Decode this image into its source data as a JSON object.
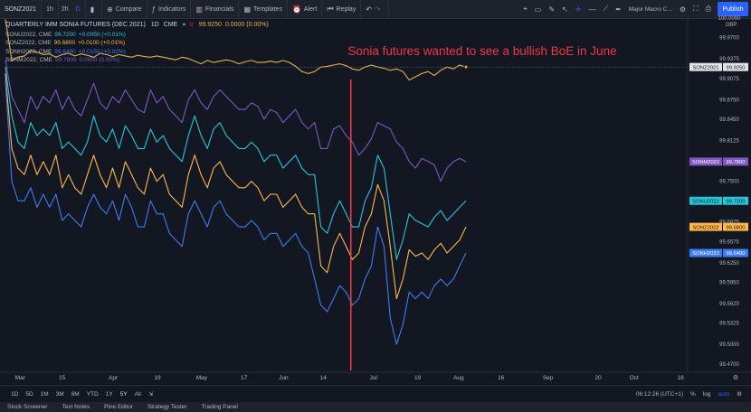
{
  "toolbar": {
    "symbol": "SONZ2021",
    "intervals": [
      "1h",
      "2h",
      "D"
    ],
    "compare": "Compare",
    "indicators": "Indicators",
    "financials": "Financials",
    "templates": "Templates",
    "alert": "Alert",
    "replay": "Replay",
    "layout_name": "Major Macro C...",
    "publish": "Publish"
  },
  "legend": {
    "title": "QUARTERLY IMM SONIA FUTURES (DEC 2021)",
    "interval": "1D",
    "exchange": "CME",
    "main_value": "99.9250",
    "main_change": "0.0000 (0.00%)",
    "rows": [
      {
        "sym": "SONU2022, CME",
        "val": "99.7200",
        "chg": "+0.0050 (+0.01%)",
        "color": "#26c6da"
      },
      {
        "sym": "SONZ2022, CME",
        "val": "99.6800",
        "chg": "+0.0100 (+0.01%)",
        "color": "#ffb74d"
      },
      {
        "sym": "SONH2023, CME",
        "val": "99.6400",
        "chg": "+0.0150 (+0.02%)",
        "color": "#3f7bf0"
      },
      {
        "sym": "SONM2022, CME",
        "val": "99.7800",
        "chg": "0.0000 (0.00%)",
        "color": "#7e57c2"
      }
    ]
  },
  "bottom": {
    "ranges": [
      "1D",
      "5D",
      "1M",
      "3M",
      "6M",
      "YTD",
      "1Y",
      "5Y",
      "All"
    ],
    "active_range": "5Y",
    "time": "06:12:26 (UTC+1)",
    "percent": "%",
    "log": "log",
    "auto": "auto"
  },
  "tabs": [
    "Stock Screener",
    "Text Notes",
    "Pine Editor",
    "Strategy Tester",
    "Trading Panel"
  ],
  "colors": {
    "main": "#e3b04b",
    "m22": "#7e57c2",
    "u22": "#26c6da",
    "z22": "#ffb74d",
    "h23": "#3f7bf0",
    "annotation": "#f23645"
  },
  "chart_data": {
    "type": "line",
    "title": "",
    "annotation": "Sonia futures wanted to see a bullish BoE in June",
    "currency": "GBP",
    "ylim": [
      99.46,
      100.0
    ],
    "yticks": [
      100.0,
      99.97,
      99.9375,
      99.9075,
      99.875,
      99.845,
      99.8125,
      99.78,
      99.75,
      99.72,
      99.6875,
      99.6575,
      99.625,
      99.595,
      99.5625,
      99.5325,
      99.5,
      99.47
    ],
    "ytick_labels": [
      "100.0000",
      "99.9700",
      "99.9375",
      "99.9075",
      "99.8750",
      "99.8450",
      "99.8125",
      "99.7800",
      "99.7500",
      "99.7200",
      "99.6875",
      "99.6575",
      "99.6250",
      "99.5950",
      "99.5625",
      "99.5325",
      "99.5000",
      "99.4700"
    ],
    "x_ticks": [
      {
        "label": "Mar",
        "pos": 0.032
      },
      {
        "label": "15",
        "pos": 0.123
      },
      {
        "label": "Apr",
        "pos": 0.234
      },
      {
        "label": "19",
        "pos": 0.33
      },
      {
        "label": "May",
        "pos": 0.426
      },
      {
        "label": "17",
        "pos": 0.518
      },
      {
        "label": "Jun",
        "pos": 0.604
      },
      {
        "label": "14",
        "pos": 0.69
      },
      {
        "label": "Jul",
        "pos": 0.799
      },
      {
        "label": "19",
        "pos": 0.895
      },
      {
        "label": "Aug",
        "pos": 0.984
      },
      {
        "label": "16",
        "pos": 1.076
      },
      {
        "label": "Sep",
        "pos": 1.178
      },
      {
        "label": "20",
        "pos": 1.287
      },
      {
        "label": "Oct",
        "pos": 1.365
      },
      {
        "label": "18",
        "pos": 1.466
      }
    ],
    "vline_pos": 0.75,
    "series": [
      {
        "name": "SONZ2021",
        "last": "99.9250",
        "values": [
          99.998,
          99.935,
          99.94,
          99.942,
          99.95,
          99.948,
          99.944,
          99.945,
          99.94,
          99.944,
          99.946,
          99.942,
          99.945,
          99.943,
          99.94,
          99.946,
          99.944,
          99.941,
          99.944,
          99.942,
          99.94,
          99.943,
          99.941,
          99.94,
          99.942,
          99.94,
          99.938,
          99.936,
          99.94,
          99.938,
          99.934,
          99.93,
          99.935,
          99.932,
          99.934,
          99.936,
          99.934,
          99.93,
          99.933,
          99.935,
          99.932,
          99.932,
          99.934,
          99.932,
          99.935,
          99.932,
          99.926,
          99.918,
          99.915,
          99.918,
          99.925,
          99.926,
          99.928,
          99.93,
          99.927,
          99.922,
          99.92,
          99.925,
          99.928,
          99.925,
          99.923,
          99.92,
          99.922,
          99.918,
          99.905,
          99.91,
          99.915,
          99.918,
          99.912,
          99.92,
          99.925,
          99.922,
          99.928,
          99.925
        ]
      },
      {
        "name": "SONM2022",
        "last": "99.7800",
        "values": [
          99.935,
          99.88,
          99.86,
          99.84,
          99.88,
          99.86,
          99.88,
          99.87,
          99.89,
          99.86,
          99.88,
          99.86,
          99.85,
          99.875,
          99.9,
          99.87,
          99.86,
          99.88,
          99.87,
          99.89,
          99.875,
          99.86,
          99.855,
          99.89,
          99.87,
          99.88,
          99.86,
          99.85,
          99.84,
          99.875,
          99.89,
          99.87,
          99.86,
          99.88,
          99.89,
          99.88,
          99.87,
          99.86,
          99.86,
          99.87,
          99.865,
          99.845,
          99.86,
          99.855,
          99.84,
          99.85,
          99.86,
          99.84,
          99.83,
          99.84,
          99.8,
          99.8,
          99.83,
          99.835,
          99.82,
          99.81,
          99.79,
          99.8,
          99.815,
          99.84,
          99.835,
          99.83,
          99.81,
          99.8,
          99.78,
          99.77,
          99.785,
          99.78,
          99.775,
          99.75,
          99.77,
          99.78,
          99.785,
          99.78
        ]
      },
      {
        "name": "SONU2022",
        "last": "99.7200",
        "values": [
          99.925,
          99.85,
          99.81,
          99.8,
          99.84,
          99.82,
          99.83,
          99.82,
          99.84,
          99.8,
          99.81,
          99.8,
          99.79,
          99.81,
          99.85,
          99.82,
          99.81,
          99.83,
          99.8,
          99.835,
          99.82,
          99.8,
          99.8,
          99.83,
          99.81,
          99.82,
          99.8,
          99.79,
          99.78,
          99.82,
          99.85,
          99.82,
          99.8,
          99.83,
          99.84,
          99.82,
          99.81,
          99.8,
          99.8,
          99.81,
          99.8,
          99.78,
          99.79,
          99.79,
          99.77,
          99.78,
          99.79,
          99.77,
          99.76,
          99.76,
          99.68,
          99.67,
          99.7,
          99.72,
          99.7,
          99.68,
          99.68,
          99.72,
          99.74,
          99.79,
          99.77,
          99.7,
          99.63,
          99.66,
          99.7,
          99.69,
          99.685,
          99.68,
          99.695,
          99.705,
          99.69,
          99.7,
          99.71,
          99.72
        ]
      },
      {
        "name": "SONZ2022",
        "last": "99.6800",
        "values": [
          99.915,
          99.8,
          99.77,
          99.76,
          99.79,
          99.76,
          99.78,
          99.76,
          99.79,
          99.74,
          99.76,
          99.74,
          99.73,
          99.76,
          99.79,
          99.76,
          99.74,
          99.77,
          99.74,
          99.78,
          99.76,
          99.74,
          99.73,
          99.77,
          99.75,
          99.76,
          99.73,
          99.72,
          99.71,
          99.76,
          99.79,
          99.76,
          99.74,
          99.77,
          99.78,
          99.76,
          99.75,
          99.74,
          99.74,
          99.75,
          99.74,
          99.72,
          99.73,
          99.73,
          99.71,
          99.72,
          99.73,
          99.71,
          99.7,
          99.7,
          99.62,
          99.61,
          99.65,
          99.67,
          99.65,
          99.63,
          99.64,
          99.68,
          99.7,
          99.745,
          99.72,
          99.65,
          99.57,
          99.6,
          99.645,
          99.635,
          99.64,
          99.63,
          99.645,
          99.655,
          99.64,
          99.65,
          99.66,
          99.68
        ]
      },
      {
        "name": "SONH2023",
        "last": "99.6400",
        "values": [
          99.905,
          99.75,
          99.72,
          99.72,
          99.74,
          99.71,
          99.73,
          99.71,
          99.73,
          99.69,
          99.7,
          99.69,
          99.68,
          99.71,
          99.73,
          99.71,
          99.7,
          99.72,
          99.69,
          99.73,
          99.71,
          99.68,
          99.68,
          99.72,
          99.7,
          99.7,
          99.67,
          99.66,
          99.65,
          99.7,
          99.72,
          99.7,
          99.68,
          99.71,
          99.72,
          99.7,
          99.69,
          99.68,
          99.68,
          99.69,
          99.68,
          99.66,
          99.67,
          99.67,
          99.65,
          99.66,
          99.67,
          99.65,
          99.64,
          99.6,
          99.56,
          99.55,
          99.57,
          99.59,
          99.58,
          99.56,
          99.57,
          99.6,
          99.62,
          99.68,
          99.65,
          99.54,
          99.5,
          99.53,
          99.58,
          99.57,
          99.58,
          99.57,
          99.59,
          99.6,
          99.59,
          99.6,
          99.62,
          99.64
        ]
      }
    ]
  }
}
